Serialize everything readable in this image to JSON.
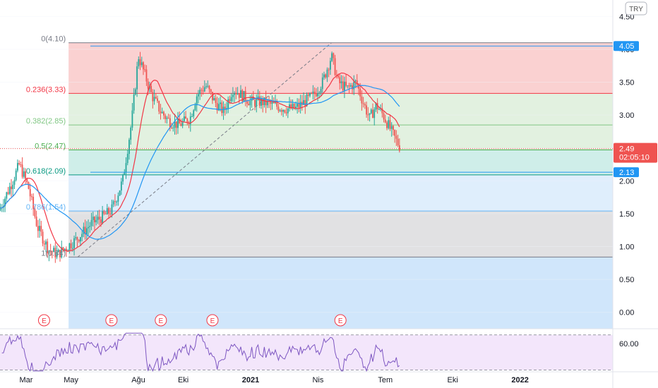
{
  "currency_button": "TRY",
  "chart_data": {
    "type": "candlestick",
    "price_axis": {
      "ticks": [
        "4.50",
        "4.00",
        "3.50",
        "3.00",
        "2.50",
        "2.00",
        "1.50",
        "1.00",
        "0.50",
        "0.00"
      ],
      "tick_values": [
        4.5,
        4.0,
        3.5,
        3.0,
        2.5,
        2.0,
        1.5,
        1.0,
        0.5,
        0.0
      ],
      "range": [
        -0.25,
        4.75
      ]
    },
    "time_axis": {
      "labels": [
        "Mar",
        "May",
        "Ağu",
        "Eki",
        "2021",
        "Nis",
        "Tem",
        "Eki",
        "2022"
      ],
      "bold_labels": [
        "2021",
        "2022"
      ]
    },
    "last_price": {
      "value": "2.49",
      "countdown": "02:05:10",
      "color": "#ef5350"
    },
    "price_tags": [
      {
        "label": "4.05",
        "value": 4.05,
        "color": "#2196f3"
      },
      {
        "label": "2.13",
        "value": 2.13,
        "color": "#2196f3"
      }
    ],
    "fibonacci": [
      {
        "label": "0(4.10)",
        "value": 4.1,
        "fill": "#fad1d1",
        "line": "#787b86",
        "text_color": "#787b86"
      },
      {
        "label": "0.236(3.33)",
        "value": 3.33,
        "fill": "#e2f1e0",
        "line": "#f23645",
        "text_color": "#f23645"
      },
      {
        "label": "0.382(2.85)",
        "value": 2.85,
        "fill": "#e2f1e0",
        "line": "#81c784",
        "text_color": "#81c784"
      },
      {
        "label": "0.5(2.47)",
        "value": 2.47,
        "fill": "#cfeee9",
        "line": "#4caf50",
        "text_color": "#4caf50"
      },
      {
        "label": "0.618(2.09)",
        "value": 2.09,
        "fill": "#dfeefc",
        "line": "#089981",
        "text_color": "#089981"
      },
      {
        "label": "0.786(1.54)",
        "value": 1.54,
        "fill": "#e1e1e3",
        "line": "#64b5f6",
        "text_color": "#64b5f6"
      },
      {
        "label": "1(0.84)",
        "value": 0.84,
        "fill": "#d0e6fb",
        "line": "#787b86",
        "text_color": "#787b86"
      }
    ],
    "trendline": {
      "from": {
        "month": 2.3,
        "value": 0.84
      },
      "to": {
        "month": 13.6,
        "value": 4.1
      },
      "color": "#787b86"
    },
    "events": [
      {
        "label": "E",
        "month": 0.8
      },
      {
        "label": "E",
        "month": 3.8
      },
      {
        "label": "E",
        "month": 6.0
      },
      {
        "label": "E",
        "month": 8.3
      },
      {
        "label": "E",
        "month": 14.0
      }
    ],
    "rsi": {
      "ticks": [
        "60.00"
      ],
      "tick_values": [
        60
      ],
      "range": [
        28,
        77
      ],
      "bands": [
        30,
        70
      ],
      "fill": "#f3e6fb",
      "line": "#7e57c2"
    },
    "ma_colors": {
      "ma_red": "#f23645",
      "ma_blue": "#2196f3"
    },
    "up_color": "#26a69a",
    "down_color": "#ef5350"
  }
}
